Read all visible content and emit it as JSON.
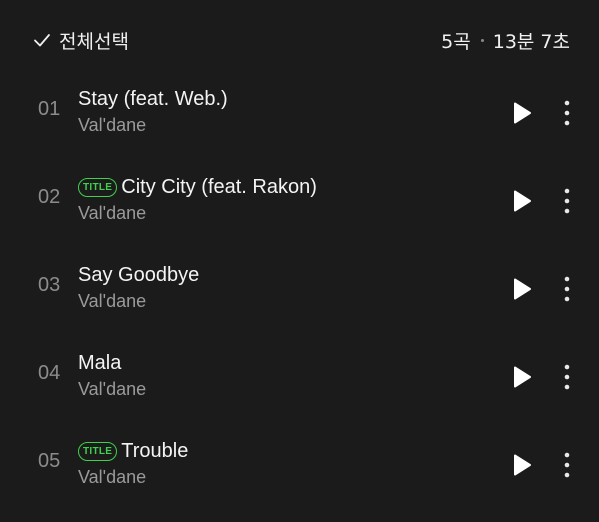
{
  "header": {
    "select_all_label": "전체선택",
    "song_count": "5곡",
    "total_duration": "13분 7초"
  },
  "badge_label": "TITLE",
  "colors": {
    "background": "#1b1b1b",
    "badge_green": "#3fd14c",
    "primary_text": "#f4f4f4",
    "secondary_text": "#9a9a9a"
  },
  "icons": {
    "select_all": "check-icon",
    "play": "play-icon",
    "more": "more-vertical-icon"
  },
  "tracks": [
    {
      "number": "01",
      "title": "Stay (feat. Web.)",
      "artist": "Val'dane",
      "is_title": false
    },
    {
      "number": "02",
      "title": "City City (feat. Rakon)",
      "artist": "Val'dane",
      "is_title": true
    },
    {
      "number": "03",
      "title": "Say Goodbye",
      "artist": "Val'dane",
      "is_title": false
    },
    {
      "number": "04",
      "title": "Mala",
      "artist": "Val'dane",
      "is_title": false
    },
    {
      "number": "05",
      "title": "Trouble",
      "artist": "Val'dane",
      "is_title": true
    }
  ]
}
